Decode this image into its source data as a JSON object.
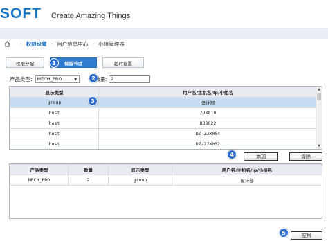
{
  "header": {
    "logo": "SOFT",
    "tagline": "Create Amazing Things"
  },
  "breadcrumb": {
    "items": [
      "权限设置",
      "用户信息中心",
      "小组管理器"
    ]
  },
  "tabs": [
    {
      "label": "权限分配",
      "active": false
    },
    {
      "label": "保留节点",
      "active": true
    },
    {
      "label": "超时设置",
      "active": false
    }
  ],
  "filters": {
    "product_type_label": "产品类型:",
    "product_type_value": "MECH_PRO",
    "count_label": "数量:",
    "count_value": "2"
  },
  "top_table": {
    "columns": [
      "显示类型",
      "用户名/主机名/Ip/小组名"
    ],
    "rows": [
      {
        "type": "group",
        "name": "设计部",
        "selected": true
      },
      {
        "type": "host",
        "name": "ZJX010",
        "selected": false
      },
      {
        "type": "host",
        "name": "BJB022",
        "selected": false
      },
      {
        "type": "host",
        "name": "DZ-ZJX054",
        "selected": false
      },
      {
        "type": "host",
        "name": "DZ-ZJX052",
        "selected": false
      }
    ]
  },
  "buttons": {
    "add": "添加",
    "clear": "清除",
    "apply": "应用"
  },
  "bottom_table": {
    "columns": [
      "产品类型",
      "数量",
      "显示类型",
      "用户名/主机名/Ip/小组名"
    ],
    "rows": [
      {
        "product": "MECH_PRO",
        "count": "2",
        "type": "group",
        "name": "设计部"
      }
    ]
  },
  "badges": [
    "1",
    "2",
    "3",
    "4",
    "5"
  ],
  "colors": {
    "brand": "#1b78c6",
    "active_tab": "#2f7dd1",
    "badge": "#2f6fd0",
    "selected_row": "#c7dcf1"
  }
}
